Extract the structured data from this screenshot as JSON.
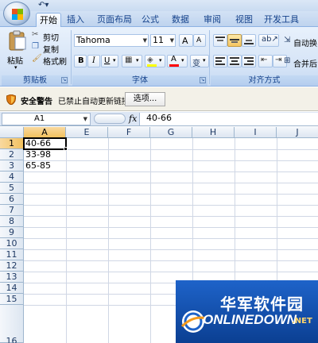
{
  "tabs": [
    "开始",
    "插入",
    "页面布局",
    "公式",
    "数据",
    "审阅",
    "视图",
    "开发工具"
  ],
  "active_tab": "开始",
  "clipboard": {
    "paste": "粘贴",
    "cut": "剪切",
    "copy": "复制",
    "format_painter": "格式刷",
    "group_label": "剪贴板"
  },
  "font": {
    "name": "Tahoma",
    "size": "11",
    "bold": "B",
    "italic": "I",
    "underline": "U",
    "color_letter": "A",
    "phonetic": "变",
    "grow": "A",
    "shrink": "A",
    "group_label": "字体"
  },
  "alignment": {
    "wrap_text": "自动换",
    "merge_center": "合并后",
    "group_label": "对齐方式"
  },
  "security": {
    "title": "安全警告",
    "message": "已禁止自动更新链接",
    "options_button": "选项..."
  },
  "formula_bar": {
    "name_box": "A1",
    "fx": "fx",
    "content": "40-66"
  },
  "grid": {
    "columns": [
      "A",
      "E",
      "F",
      "G",
      "H",
      "I",
      "J"
    ],
    "rows": [
      "1",
      "2",
      "3",
      "4",
      "5",
      "6",
      "7",
      "8",
      "9",
      "10",
      "11",
      "12",
      "13",
      "14",
      "15",
      "16"
    ],
    "cells": {
      "A1": "40-66",
      "A2": "33-98",
      "A3": "65-85"
    }
  },
  "watermark": {
    "cn": "华军软件园",
    "en": "ONLINEDOWN",
    "suffix": ".NET"
  },
  "colors": {
    "ribbon": "#dbe7f6",
    "tab_text": "#15428b",
    "selected_header": "#f1c15f",
    "gridline": "#d0d7e5",
    "watermark_bg": "#0b3f92"
  }
}
